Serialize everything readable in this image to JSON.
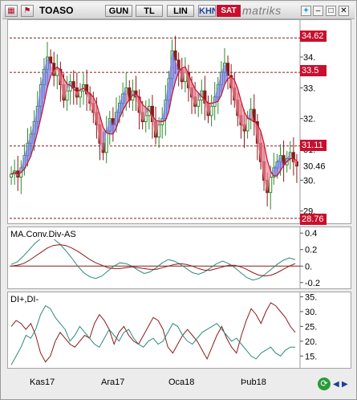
{
  "toolbar": {
    "symbol": "TOASO",
    "buttons": [
      "GUN",
      "TL",
      "LIN",
      "KHN"
    ],
    "status_badge": "SAT",
    "brand": "matriks",
    "accent": "#c8102e"
  },
  "chart_data": [
    {
      "type": "candlestick",
      "title": "",
      "ylim": [
        28.6,
        35.2
      ],
      "yticks": [
        29,
        30,
        31,
        32,
        33,
        34
      ],
      "ytick_labels": [
        "29.",
        "30.",
        "31.",
        "32.",
        "33.",
        "34."
      ],
      "last_value_label": "30.46",
      "price_tags": [
        "34.62",
        "33.5",
        "31.11",
        "28.76"
      ],
      "horizontal_levels": [
        34.62,
        33.5,
        31.11,
        28.76
      ],
      "x_tick_labels": [
        "Kas17",
        "Ara17",
        "Oca18",
        "Þub18"
      ],
      "colors": {
        "up": "#2e8b2e",
        "down": "#8b1a1a",
        "ma_fill_up": "#7777ee",
        "ma_fill_down": "#f08a9a"
      },
      "series": [
        {
          "candles_close": [
            30.2,
            30.3,
            30.1,
            30.4,
            30.8,
            31.2,
            31.5,
            31.9,
            32.4,
            33.1,
            33.6,
            34.0,
            33.8,
            33.4,
            33.6,
            33.1,
            32.6,
            32.9,
            33.2,
            33.0,
            32.7,
            32.9,
            33.1,
            32.8,
            32.5,
            32.2,
            31.8,
            31.2,
            30.9,
            31.6,
            32.0,
            31.8,
            32.2,
            32.5,
            32.8,
            33.0,
            32.6,
            32.9,
            32.7,
            32.2,
            31.9,
            32.1,
            32.4,
            31.9,
            31.4,
            31.8,
            32.0,
            32.6,
            33.3,
            34.2,
            33.9,
            33.6,
            33.2,
            33.5,
            33.0,
            32.7,
            32.4,
            32.6,
            32.9,
            32.5,
            32.1,
            32.4,
            32.7,
            33.1,
            33.5,
            33.8,
            33.4,
            33.0,
            32.6,
            32.1,
            31.8,
            31.6,
            32.0,
            32.3,
            31.9,
            31.2,
            30.6,
            30.0,
            29.6,
            30.1,
            30.4,
            30.6,
            30.8,
            30.5,
            30.7,
            30.9,
            30.6,
            30.46
          ]
        }
      ]
    },
    {
      "type": "line",
      "title": "MA.Conv.Div-AS",
      "ylim": [
        -0.27,
        0.47
      ],
      "yticks": [
        0.4,
        0.2,
        0.0,
        -0.2
      ],
      "ytick_labels": [
        "0.4",
        "0.2",
        "0.",
        "-0.2"
      ],
      "series": [
        {
          "color": "#2a8a7a",
          "values": [
            0.02,
            0.05,
            0.12,
            0.2,
            0.28,
            0.34,
            0.36,
            0.33,
            0.27,
            0.19,
            0.1,
            0.0,
            -0.08,
            -0.13,
            -0.15,
            -0.12,
            -0.06,
            0.0,
            0.04,
            0.03,
            0.0,
            -0.05,
            -0.09,
            -0.07,
            -0.02,
            0.04,
            0.08,
            0.06,
            0.02,
            -0.03,
            -0.08,
            -0.1,
            -0.07,
            -0.02,
            0.03,
            0.06,
            0.03,
            -0.02,
            -0.08,
            -0.14,
            -0.17,
            -0.15,
            -0.1,
            -0.04,
            0.02,
            0.07,
            0.1,
            0.08
          ]
        },
        {
          "color": "#8b1a1a",
          "values": [
            0.0,
            0.01,
            0.03,
            0.07,
            0.12,
            0.17,
            0.22,
            0.25,
            0.26,
            0.25,
            0.22,
            0.18,
            0.13,
            0.08,
            0.04,
            0.01,
            -0.02,
            -0.03,
            -0.03,
            -0.02,
            -0.01,
            -0.02,
            -0.03,
            -0.04,
            -0.04,
            -0.02,
            0.0,
            0.02,
            0.03,
            0.02,
            0.0,
            -0.03,
            -0.05,
            -0.05,
            -0.03,
            -0.01,
            0.01,
            0.01,
            -0.01,
            -0.04,
            -0.08,
            -0.11,
            -0.12,
            -0.11,
            -0.08,
            -0.04,
            0.0,
            0.03
          ]
        }
      ]
    },
    {
      "type": "line",
      "title": "DI+,DI-",
      "ylim": [
        11,
        36.5
      ],
      "yticks": [
        35,
        30,
        25,
        20,
        15
      ],
      "ytick_labels": [
        "35.",
        "30.",
        "25.",
        "20.",
        "15."
      ],
      "series": [
        {
          "color": "#8b1a1a",
          "values": [
            25,
            27,
            26,
            24,
            26,
            22,
            16,
            13,
            15,
            20,
            23,
            21,
            19,
            18,
            20,
            22,
            21,
            26,
            29,
            27,
            24,
            19,
            23,
            25,
            22,
            20,
            19,
            22,
            25,
            28,
            27,
            24,
            18,
            16,
            19,
            22,
            24,
            22,
            20,
            17,
            14,
            18,
            22,
            25,
            21,
            18,
            16,
            22,
            27,
            31,
            29,
            26,
            30,
            33,
            32,
            30,
            28,
            25,
            23
          ]
        },
        {
          "color": "#2a8a7a",
          "values": [
            12,
            15,
            18,
            22,
            21,
            24,
            29,
            32,
            31,
            28,
            26,
            24,
            20,
            22,
            25,
            23,
            21,
            19,
            18,
            21,
            24,
            22,
            20,
            23,
            24,
            21,
            19,
            18,
            20,
            21,
            19,
            20,
            23,
            26,
            25,
            22,
            20,
            19,
            21,
            23,
            24,
            25,
            26,
            24,
            22,
            20,
            21,
            19,
            17,
            15,
            14,
            16,
            17,
            18,
            16,
            15,
            17,
            18,
            18
          ]
        }
      ]
    }
  ]
}
